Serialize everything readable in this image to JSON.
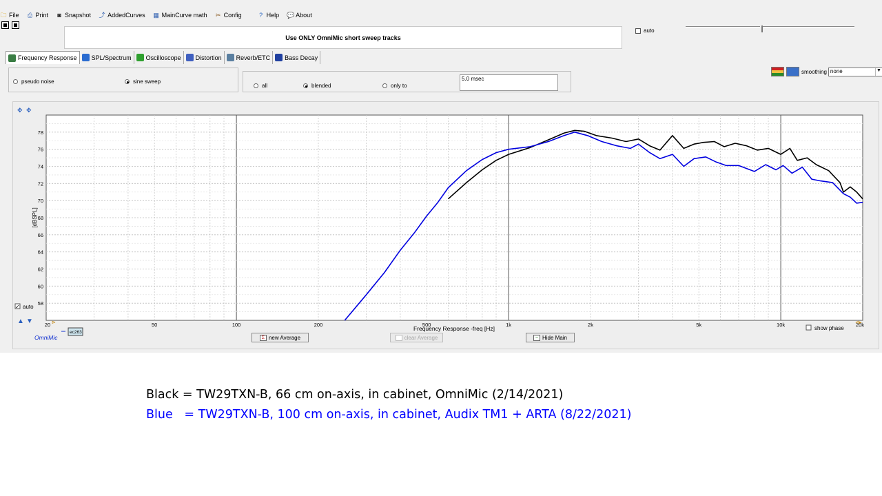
{
  "menu": {
    "items": [
      {
        "label": "File",
        "icon": "folder-icon",
        "glyph": "🗀",
        "color": "#d9a000"
      },
      {
        "label": "Print",
        "icon": "print-icon",
        "glyph": "⎙",
        "color": "#3060b0"
      },
      {
        "label": "Snapshot",
        "icon": "camera-icon",
        "glyph": "◙",
        "color": "#222222"
      },
      {
        "label": "AddedCurves",
        "icon": "curves-icon",
        "glyph": "⤴",
        "color": "#3060b0"
      },
      {
        "label": "MainCurve math",
        "icon": "calculator-icon",
        "glyph": "▦",
        "color": "#3060b0"
      },
      {
        "label": "Config",
        "icon": "tools-icon",
        "glyph": "✂",
        "color": "#8a5a20"
      },
      {
        "label": "Help",
        "icon": "help-icon",
        "glyph": "?",
        "color": "#1f5fbf"
      },
      {
        "label": "About",
        "icon": "about-icon",
        "glyph": "💬",
        "color": "#1f5fbf"
      }
    ]
  },
  "header": {
    "title": "Use ONLY OmniMic short sweep tracks",
    "auto_label": "auto"
  },
  "tabs": [
    {
      "label": "Frequency Response",
      "active": true,
      "icon": "frequency-response-icon",
      "color": "#3a7d44"
    },
    {
      "label": "SPL/Spectrum",
      "active": false,
      "icon": "spl-spectrum-icon",
      "color": "#2a6cd0"
    },
    {
      "label": "Oscilloscope",
      "active": false,
      "icon": "oscilloscope-icon",
      "color": "#2fa02f"
    },
    {
      "label": "Distortion",
      "active": false,
      "icon": "distortion-icon",
      "color": "#4060c0"
    },
    {
      "label": "Reverb/ETC",
      "active": false,
      "icon": "reverb-icon",
      "color": "#5a7fa0"
    },
    {
      "label": "Bass Decay",
      "active": false,
      "icon": "bass-decay-icon",
      "color": "#2040a0"
    }
  ],
  "signal": {
    "options": [
      {
        "label": "pseudo noise",
        "selected": false
      },
      {
        "label": "sine sweep",
        "selected": true
      }
    ]
  },
  "gating": {
    "options": [
      {
        "label": "all",
        "selected": false
      },
      {
        "label": "blended",
        "selected": true
      },
      {
        "label": "only to",
        "selected": false
      }
    ],
    "gate_value": "5.0 msec"
  },
  "smoothing": {
    "label": "smoothing",
    "value": "none"
  },
  "plot": {
    "y_axis_label": "[dBSPL]",
    "x_axis_label": "Frequency Response -freq [Hz]",
    "auto_label": "auto",
    "auto_checked": true,
    "show_phase_label": "show phase",
    "mic_label": "OmniMic",
    "mic_id": "ec263",
    "buttons": {
      "new_average": "new Average",
      "clear_average": "clear Average",
      "hide_main": "Hide Main"
    }
  },
  "chart_data": {
    "type": "line",
    "x_scale": "log",
    "xlim": [
      20,
      20000
    ],
    "ylim": [
      56,
      80
    ],
    "x_ticks": [
      20,
      50,
      100,
      200,
      500,
      1000,
      2000,
      5000,
      10000
    ],
    "x_tick_labels": [
      "20",
      "50",
      "100",
      "200",
      "500",
      "1k",
      "2k",
      "5k",
      "10k",
      "20k"
    ],
    "y_ticks": [
      58,
      60,
      62,
      64,
      66,
      68,
      70,
      72,
      74,
      76,
      78
    ],
    "grid": true,
    "series": [
      {
        "color": "#000000",
        "points": [
          [
            600,
            70.2
          ],
          [
            700,
            72.1
          ],
          [
            800,
            73.6
          ],
          [
            900,
            74.7
          ],
          [
            1000,
            75.4
          ],
          [
            1200,
            76.2
          ],
          [
            1400,
            77.1
          ],
          [
            1600,
            77.9
          ],
          [
            1750,
            78.2
          ],
          [
            1900,
            78.1
          ],
          [
            2100,
            77.6
          ],
          [
            2400,
            77.3
          ],
          [
            2700,
            76.9
          ],
          [
            3000,
            77.2
          ],
          [
            3300,
            76.4
          ],
          [
            3600,
            75.9
          ],
          [
            4000,
            77.6
          ],
          [
            4400,
            76.1
          ],
          [
            4800,
            76.6
          ],
          [
            5200,
            76.8
          ],
          [
            5700,
            76.9
          ],
          [
            6200,
            76.3
          ],
          [
            6800,
            76.7
          ],
          [
            7500,
            76.4
          ],
          [
            8200,
            75.9
          ],
          [
            9000,
            76.1
          ],
          [
            10000,
            75.4
          ],
          [
            10800,
            76.1
          ],
          [
            11500,
            74.7
          ],
          [
            12500,
            75.0
          ],
          [
            13500,
            74.2
          ],
          [
            15000,
            73.5
          ],
          [
            16500,
            72.1
          ],
          [
            17000,
            71.0
          ],
          [
            18000,
            71.6
          ],
          [
            19000,
            71.0
          ],
          [
            20000,
            70.2
          ]
        ]
      },
      {
        "color": "#0000e0",
        "points": [
          [
            250,
            56.0
          ],
          [
            300,
            59.0
          ],
          [
            350,
            61.6
          ],
          [
            400,
            64.2
          ],
          [
            450,
            66.2
          ],
          [
            500,
            68.2
          ],
          [
            550,
            69.8
          ],
          [
            600,
            71.5
          ],
          [
            700,
            73.5
          ],
          [
            800,
            74.8
          ],
          [
            900,
            75.6
          ],
          [
            1000,
            76.0
          ],
          [
            1200,
            76.3
          ],
          [
            1400,
            76.9
          ],
          [
            1600,
            77.6
          ],
          [
            1750,
            78.0
          ],
          [
            1950,
            77.6
          ],
          [
            2200,
            76.9
          ],
          [
            2500,
            76.4
          ],
          [
            2800,
            76.1
          ],
          [
            3000,
            76.6
          ],
          [
            3300,
            75.6
          ],
          [
            3600,
            74.9
          ],
          [
            4000,
            75.4
          ],
          [
            4400,
            74.0
          ],
          [
            4800,
            74.9
          ],
          [
            5300,
            75.1
          ],
          [
            5800,
            74.5
          ],
          [
            6300,
            74.1
          ],
          [
            7000,
            74.1
          ],
          [
            8000,
            73.4
          ],
          [
            8800,
            74.2
          ],
          [
            9600,
            73.6
          ],
          [
            10200,
            74.1
          ],
          [
            11000,
            73.2
          ],
          [
            12000,
            73.9
          ],
          [
            13000,
            72.5
          ],
          [
            14000,
            72.3
          ],
          [
            15500,
            72.1
          ],
          [
            17000,
            70.8
          ],
          [
            18000,
            70.4
          ],
          [
            19000,
            69.7
          ],
          [
            20000,
            69.8
          ]
        ]
      }
    ]
  },
  "captions": {
    "black": "Black = TW29TXN-B, 66 cm on-axis, in cabinet, OmniMic (2/14/2021)",
    "blue": "Blue   = TW29TXN-B, 100 cm on-axis, in cabinet, Audix TM1 + ARTA (8/22/2021)"
  },
  "colors": {
    "black_caption": "#000000",
    "blue_caption": "#0000ff",
    "grid": "#cccccc"
  }
}
